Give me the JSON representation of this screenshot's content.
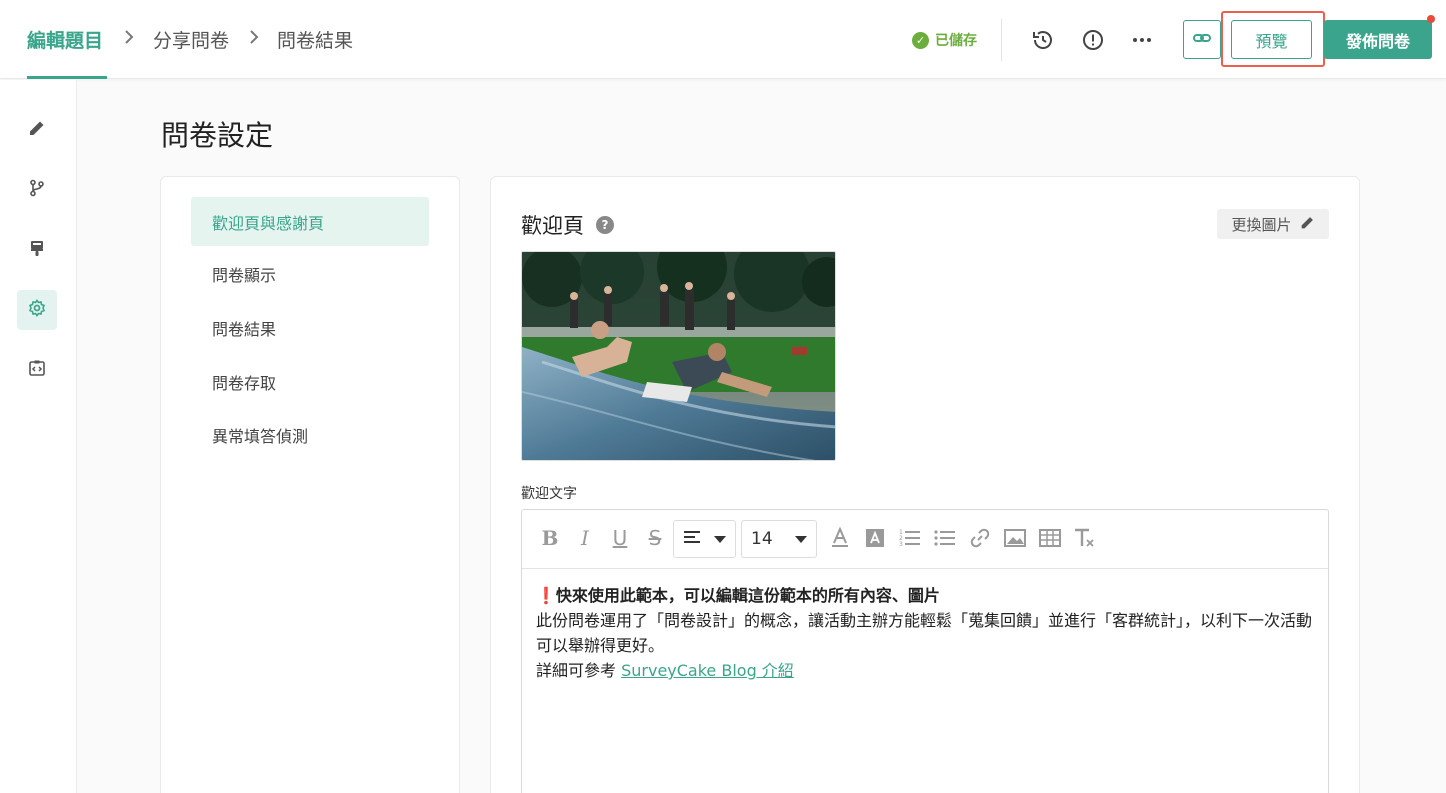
{
  "breadcrumb": {
    "items": [
      "編輯題目",
      "分享問卷",
      "問卷結果"
    ],
    "separator": ">"
  },
  "header": {
    "saved_status": "已儲存",
    "preview_label": "預覽",
    "publish_label": "發佈問卷",
    "icons": [
      "history-icon",
      "alert-icon",
      "more-icon",
      "link-icon"
    ]
  },
  "rail": {
    "items": [
      "edit-icon",
      "branch-icon",
      "paint-icon",
      "settings-icon",
      "code-icon"
    ],
    "active": "settings-icon"
  },
  "page": {
    "title": "問卷設定"
  },
  "settings_nav": {
    "items": [
      "歡迎頁與感謝頁",
      "問卷顯示",
      "問卷結果",
      "問卷存取",
      "異常填答偵測"
    ],
    "active_index": 0
  },
  "welcome_panel": {
    "title": "歡迎頁",
    "change_image_label": "更換圖片",
    "text_label": "歡迎文字",
    "font_size": "14",
    "content": {
      "headline": "快來使用此範本，可以編輯這份範本的所有內容、圖片",
      "line1": "此份問卷運用了「問卷設計」的概念，讓活動主辦方能輕鬆「蒐集回饋」並進行「客群統計」，以利下一次活動可以舉辦得更好。",
      "line2_prefix": "詳細可參考 ",
      "line2_link": "SurveyCake Blog 介紹"
    }
  },
  "colors": {
    "accent": "#3aa58c",
    "highlight": "#e9604f",
    "saved": "#6cae3c"
  }
}
